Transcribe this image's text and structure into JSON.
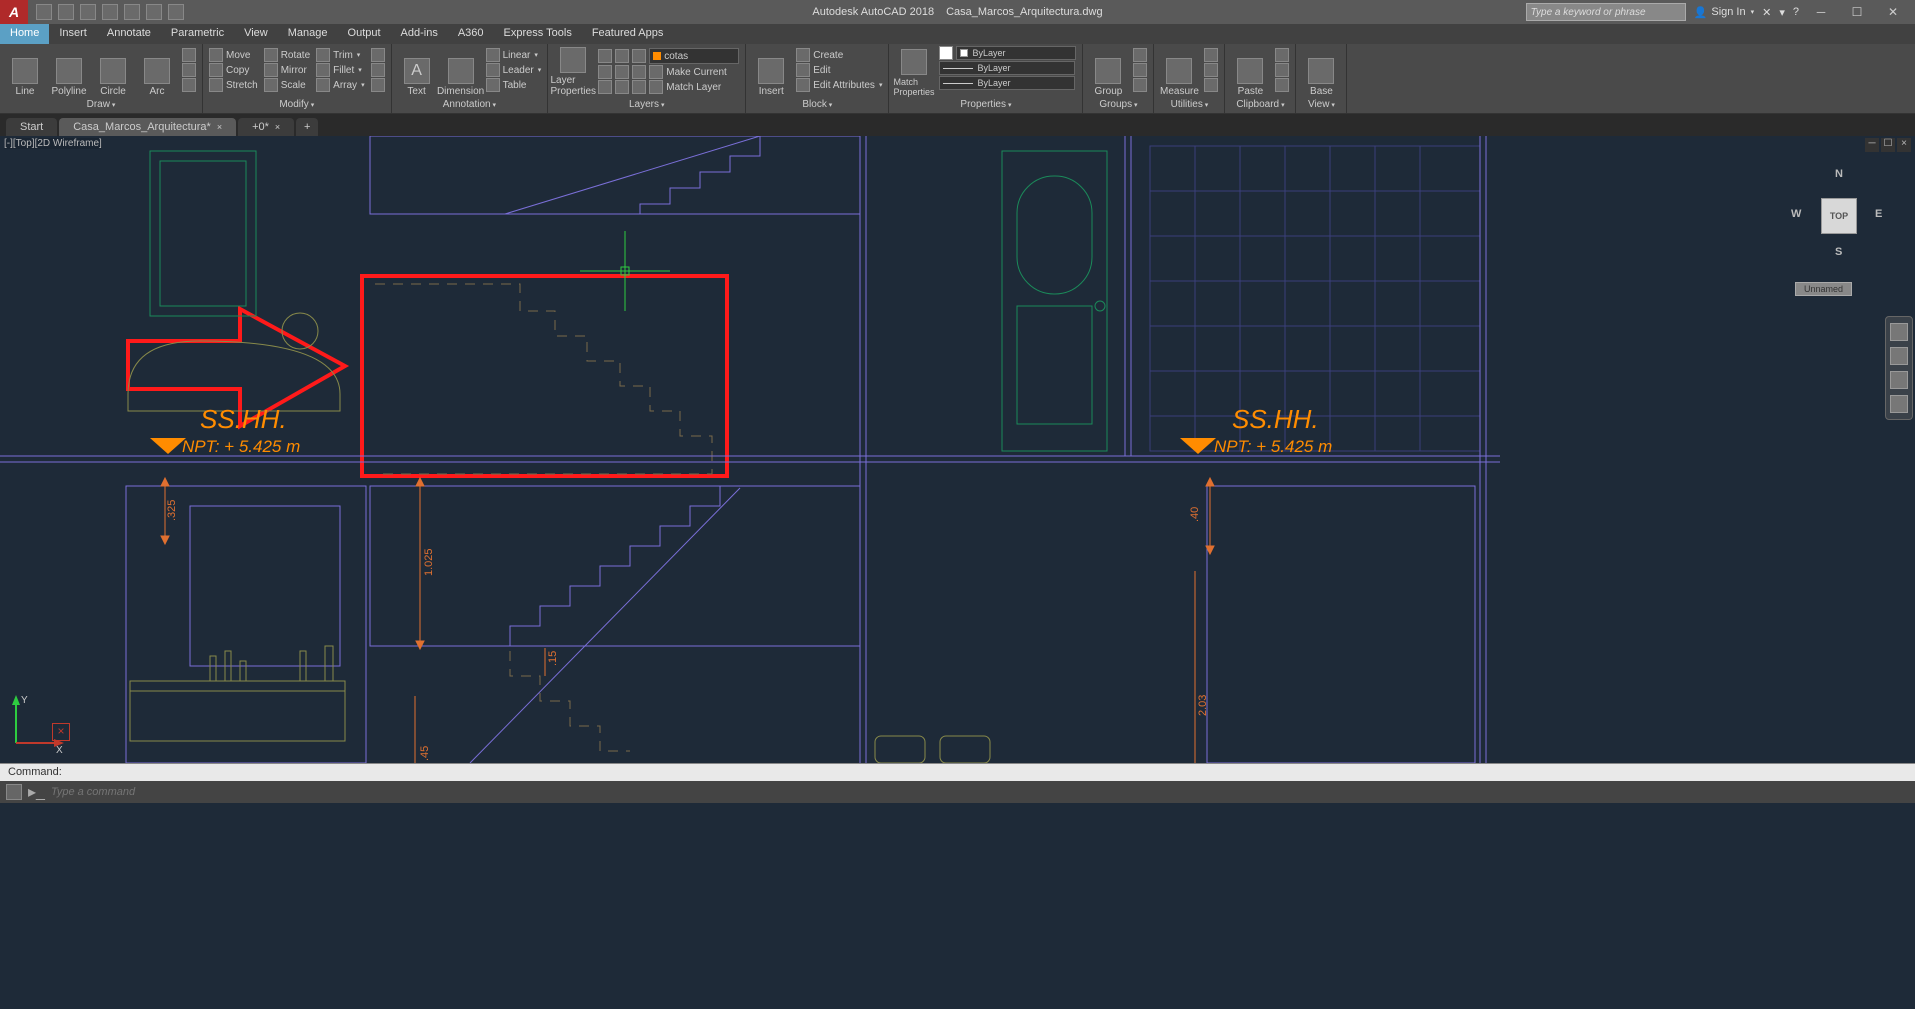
{
  "titlebar": {
    "app_name": "Autodesk AutoCAD 2018",
    "document": "Casa_Marcos_Arquitectura.dwg",
    "search_placeholder": "Type a keyword or phrase",
    "signin": "Sign In"
  },
  "menu_tabs": [
    "Home",
    "Insert",
    "Annotate",
    "Parametric",
    "View",
    "Manage",
    "Output",
    "Add-ins",
    "A360",
    "Express Tools",
    "Featured Apps"
  ],
  "menu_active": 0,
  "ribbon": {
    "draw": {
      "title": "Draw",
      "buttons": [
        "Line",
        "Polyline",
        "Circle",
        "Arc"
      ]
    },
    "modify": {
      "title": "Modify",
      "rows": [
        [
          "Move",
          "Rotate",
          "Trim"
        ],
        [
          "Copy",
          "Mirror",
          "Fillet"
        ],
        [
          "Stretch",
          "Scale",
          "Array"
        ]
      ]
    },
    "annotation": {
      "title": "Annotation",
      "big": [
        "Text",
        "Dimension"
      ],
      "rows": [
        "Linear",
        "Leader",
        "Table"
      ]
    },
    "layers": {
      "title": "Layers",
      "big": "Layer Properties",
      "current_layer": "cotas",
      "rows": [
        "Make Current",
        "Match Layer"
      ]
    },
    "block": {
      "title": "Block",
      "big": "Insert",
      "rows": [
        "Create",
        "Edit",
        "Edit Attributes"
      ]
    },
    "properties": {
      "title": "Properties",
      "big": "Match Properties",
      "color": "ByLayer",
      "lw": "ByLayer",
      "lt": "ByLayer"
    },
    "groups": {
      "title": "Groups",
      "big": "Group"
    },
    "utilities": {
      "title": "Utilities",
      "big": "Measure"
    },
    "clipboard": {
      "title": "Clipboard",
      "big": "Paste"
    },
    "view": {
      "title": "View",
      "big": "Base"
    }
  },
  "file_tabs": {
    "start": "Start",
    "active": "Casa_Marcos_Arquitectura*",
    "other": "+0*"
  },
  "viewport": {
    "label": "[-][Top][2D Wireframe]",
    "cube": "TOP",
    "dirs": {
      "n": "N",
      "e": "E",
      "s": "S",
      "w": "W"
    },
    "unnamed": "Unnamed"
  },
  "drawing": {
    "room1": {
      "label": "SS.HH.",
      "level": "NPT: + 5.425 m"
    },
    "room2": {
      "label": "SS.HH.",
      "level": "NPT: + 5.425 m"
    },
    "dims": {
      "d1": ".325",
      "d2": "1.025",
      "d3": ".15",
      "d4": ".40",
      "d5": "2.03",
      "d6": ".45"
    }
  },
  "command": {
    "history": "Command:",
    "placeholder": "Type a command"
  }
}
